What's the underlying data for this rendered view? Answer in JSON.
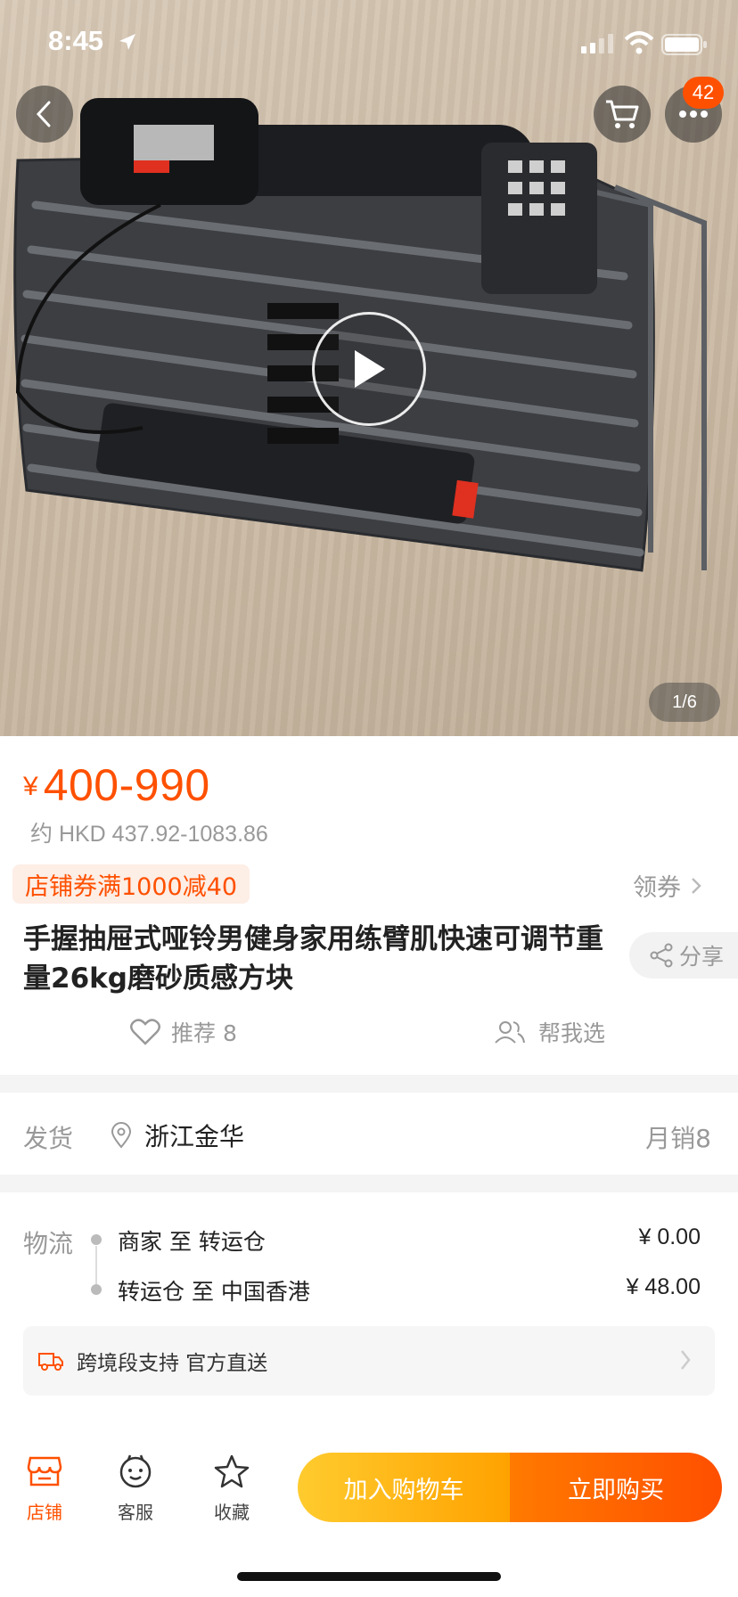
{
  "status_bar": {
    "time": "8:45"
  },
  "header": {
    "cart_badge": "42"
  },
  "media": {
    "pager": "1/6"
  },
  "price": {
    "currency": "¥",
    "range": "400-990",
    "hkd": "约 HKD 437.92-1083.86"
  },
  "coupon": {
    "tag": "店铺券满1000减40",
    "get_label": "领券"
  },
  "product": {
    "title": "手握抽屉式哑铃男健身家用练臂肌快速可调节重量26kg磨砂质感方块",
    "share_label": "分享"
  },
  "actions": {
    "recommend": "推荐 8",
    "help_choose": "帮我选"
  },
  "shipping": {
    "label": "发货",
    "location": "浙江金华",
    "monthly_sales": "月销8"
  },
  "logistics": {
    "label": "物流",
    "legs": [
      {
        "route": "商家 至 转运仓",
        "fee": "¥ 0.00"
      },
      {
        "route": "转运仓 至 中国香港",
        "fee": "¥ 48.00"
      }
    ],
    "direct": "跨境段支持 官方直送"
  },
  "bottom_bar": {
    "tabs": [
      {
        "label": "店铺"
      },
      {
        "label": "客服"
      },
      {
        "label": "收藏"
      }
    ],
    "add_to_cart": "加入购物车",
    "buy_now": "立即购买"
  },
  "colors": {
    "accent": "#ff5000",
    "cart_btn": "#ffb400",
    "buy_btn": "#ff5a00"
  }
}
